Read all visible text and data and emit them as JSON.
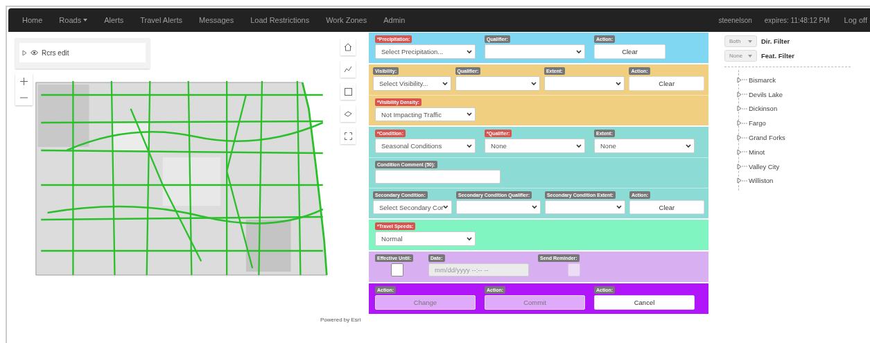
{
  "nav": {
    "items": [
      {
        "label": "Home",
        "dropdown": false
      },
      {
        "label": "Roads",
        "dropdown": true
      },
      {
        "label": "Alerts",
        "dropdown": false
      },
      {
        "label": "Travel Alerts",
        "dropdown": false
      },
      {
        "label": "Messages",
        "dropdown": false
      },
      {
        "label": "Load Restrictions",
        "dropdown": false
      },
      {
        "label": "Work Zones",
        "dropdown": false
      },
      {
        "label": "Admin",
        "dropdown": false
      }
    ],
    "user": "steenelson",
    "expires": "expires: 11:48:12 PM",
    "logoff": "Log off"
  },
  "map": {
    "layer": {
      "name": "Rcrs edit",
      "expanded": false
    },
    "attribution": "Powered by Esri"
  },
  "form": {
    "sections": [
      {
        "color": "#80d7f1",
        "rows": [
          {
            "fields": [
              {
                "kind": "select",
                "label": "*Precipitation:",
                "required": true,
                "value": "Select Precipitation..."
              },
              {
                "kind": "select",
                "label": "Qualifier:",
                "required": false
              },
              {
                "kind": "button",
                "label": "Action:",
                "required": false,
                "text": "Clear",
                "disabled": false
              }
            ]
          }
        ]
      },
      {
        "color": "#f1cf80",
        "rows": [
          {
            "fields": [
              {
                "kind": "select",
                "label": "Visibility:",
                "required": false,
                "value": "Select Visibility..."
              },
              {
                "kind": "select",
                "label": "Qualifier:",
                "required": false
              },
              {
                "kind": "select",
                "label": "Extent:",
                "required": false
              },
              {
                "kind": "button",
                "label": "Action:",
                "required": false,
                "text": "Clear",
                "disabled": false
              }
            ]
          },
          {
            "fields": [
              {
                "kind": "select",
                "label": "*Visibility Density:",
                "required": true,
                "value": "Not Impacting Traffic"
              }
            ]
          }
        ]
      },
      {
        "color": "#8cdcd5",
        "rows": [
          {
            "fields": [
              {
                "kind": "select",
                "label": "*Condition:",
                "required": true,
                "value": "Seasonal Conditions"
              },
              {
                "kind": "select",
                "label": "*Qualifier:",
                "required": true,
                "value": "None"
              },
              {
                "kind": "select",
                "label": "Extent:",
                "required": false,
                "value": "None"
              }
            ]
          },
          {
            "fields": [
              {
                "kind": "text",
                "label": "Condition Comment (50):",
                "required": false
              }
            ]
          },
          {
            "fields": [
              {
                "kind": "select",
                "label": "Secondary Condition:",
                "required": false,
                "value": "Select Secondary Cor"
              },
              {
                "kind": "select",
                "label": "Secondary Condition Qualifier:",
                "required": false
              },
              {
                "kind": "select",
                "label": "Secondary Condition Extent:",
                "required": false
              },
              {
                "kind": "button",
                "label": "Action:",
                "required": false,
                "text": "Clear",
                "disabled": false
              }
            ]
          }
        ]
      },
      {
        "color": "#80f5c1",
        "rows": [
          {
            "fields": [
              {
                "kind": "select",
                "label": "*Travel Speeds:",
                "required": true,
                "value": "Normal"
              }
            ]
          }
        ]
      },
      {
        "color": "#d8b0f1",
        "rows": [
          {
            "fields": [
              {
                "kind": "checkbox",
                "label": "Effective Until:",
                "required": false,
                "checked": false,
                "disabled": false
              },
              {
                "kind": "date",
                "label": "Date:",
                "required": false,
                "placeholder": "mm/dd/yyyy --:-- --",
                "disabled": true
              },
              {
                "kind": "checkbox",
                "label": "Send Reminder:",
                "required": false,
                "checked": false,
                "disabled": true
              }
            ]
          }
        ]
      },
      {
        "color": "#b115f9",
        "rows": [
          {
            "fields": [
              {
                "kind": "button",
                "label": "Action:",
                "required": false,
                "text": "Change",
                "disabled": true
              },
              {
                "kind": "button",
                "label": "Action:",
                "required": false,
                "text": "Commit",
                "disabled": true
              },
              {
                "kind": "button",
                "label": "Action:",
                "required": false,
                "text": "Cancel",
                "disabled": false
              }
            ]
          }
        ]
      }
    ]
  },
  "filters": [
    {
      "value": "Both",
      "label": "Dir. Filter"
    },
    {
      "value": "None",
      "label": "Feat. Filter"
    }
  ],
  "tree": [
    {
      "label": "Bismarck",
      "expanded": false
    },
    {
      "label": "Devils Lake",
      "expanded": false
    },
    {
      "label": "Dickinson",
      "expanded": false
    },
    {
      "label": "Fargo",
      "expanded": false
    },
    {
      "label": "Grand Forks",
      "expanded": false
    },
    {
      "label": "Minot",
      "expanded": false
    },
    {
      "label": "Valley City",
      "expanded": false
    },
    {
      "label": "Williston",
      "expanded": false
    }
  ]
}
